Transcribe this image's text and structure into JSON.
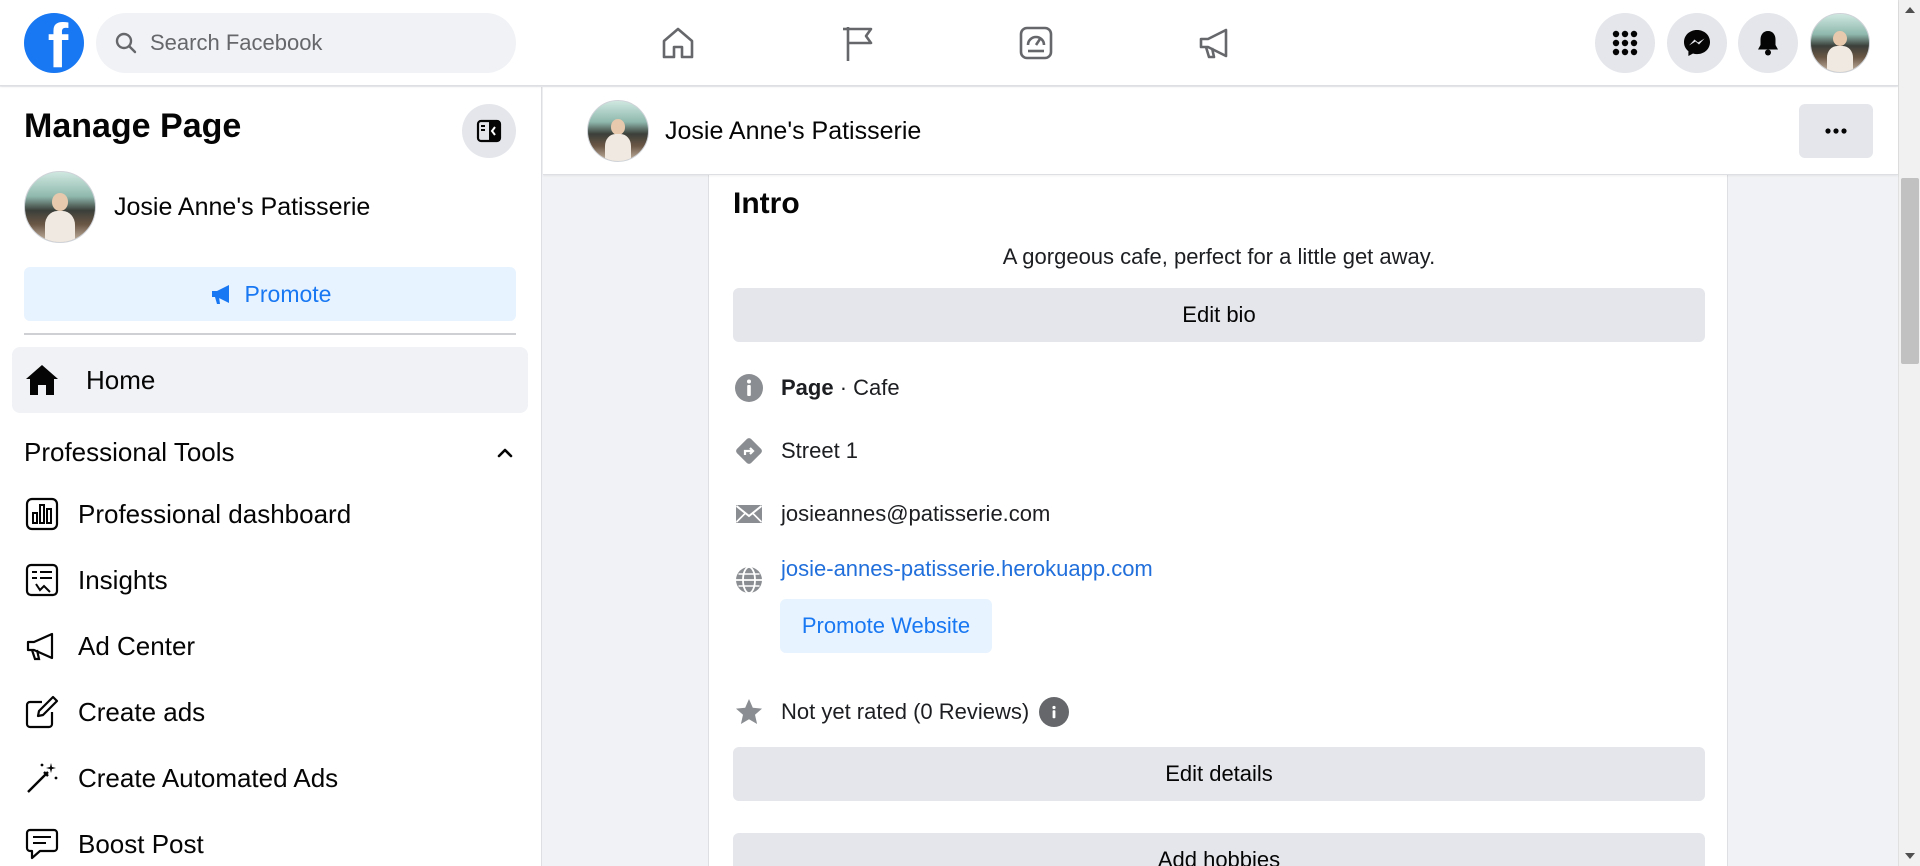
{
  "topbar": {
    "search_placeholder": "Search Facebook",
    "nav_icons": [
      "home-icon",
      "pages-flag-icon",
      "insights-dashboard-icon",
      "ad-center-megaphone-icon"
    ],
    "right_buttons": [
      "menu-grid-icon",
      "messenger-icon",
      "notifications-bell-icon",
      "account-avatar"
    ]
  },
  "sidebar": {
    "title": "Manage Page",
    "page_name": "Josie Anne's Patisserie",
    "promote_label": "Promote",
    "home_label": "Home",
    "section_label": "Professional Tools",
    "items": [
      {
        "label": "Professional dashboard",
        "icon": "dashboard-icon"
      },
      {
        "label": "Insights",
        "icon": "insights-icon"
      },
      {
        "label": "Ad Center",
        "icon": "megaphone-icon"
      },
      {
        "label": "Create ads",
        "icon": "edit-icon"
      },
      {
        "label": "Create Automated Ads",
        "icon": "magic-wand-icon"
      },
      {
        "label": "Boost Post",
        "icon": "boost-post-icon"
      }
    ]
  },
  "header": {
    "page_name": "Josie Anne's Patisserie",
    "more_icon": "more-icon"
  },
  "intro": {
    "title": "Intro",
    "bio": "A gorgeous cafe, perfect for a little get away.",
    "edit_bio_label": "Edit bio",
    "category_prefix": "Page",
    "category_sep": " · ",
    "category": "Cafe",
    "address": "Street 1",
    "email": "josieannes@patisserie.com",
    "website": "josie-annes-patisserie.herokuapp.com",
    "promote_website_label": "Promote Website",
    "rating": "Not yet rated (0 Reviews)",
    "edit_details_label": "Edit details",
    "add_hobbies_label": "Add hobbies"
  },
  "colors": {
    "brand": "#1877f2",
    "link": "#216fdb",
    "button_gray": "#e4e6eb",
    "promote_bg": "#e7f3ff"
  }
}
